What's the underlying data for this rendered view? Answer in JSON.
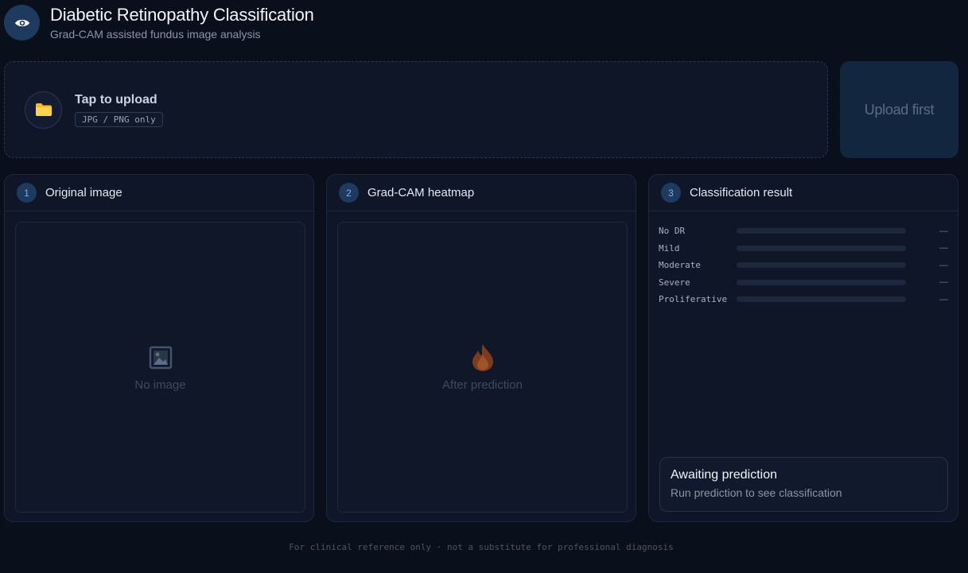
{
  "header": {
    "title": "Diabetic Retinopathy Classification",
    "subtitle": "Grad-CAM assisted fundus image analysis",
    "logo_icon": "eye-icon"
  },
  "upload": {
    "icon": "folder-icon",
    "title": "Tap to upload",
    "hint": "JPG / PNG only"
  },
  "predict_button": {
    "label": "Upload first",
    "disabled": true
  },
  "panels": [
    {
      "step": "1",
      "title": "Original image",
      "placeholder_icon": "image-placeholder-icon",
      "placeholder": "No image"
    },
    {
      "step": "2",
      "title": "Grad-CAM heatmap",
      "placeholder_icon": "flame-icon",
      "placeholder": "After prediction"
    },
    {
      "step": "3",
      "title": "Classification result"
    }
  ],
  "classes": [
    {
      "label": "No DR",
      "value": "—",
      "fraction": 0
    },
    {
      "label": "Mild",
      "value": "—",
      "fraction": 0
    },
    {
      "label": "Moderate",
      "value": "—",
      "fraction": 0
    },
    {
      "label": "Severe",
      "value": "—",
      "fraction": 0
    },
    {
      "label": "Proliferative",
      "value": "—",
      "fraction": 0
    }
  ],
  "result": {
    "title": "Awaiting prediction",
    "subtitle": "Run prediction to see classification"
  },
  "footer": "For clinical reference only · not a substitute for professional diagnosis",
  "colors": {
    "background": "#0a0f1c",
    "panel": "#0f1628",
    "accent": "#1e3a5f",
    "folder": "#fbbf24"
  }
}
